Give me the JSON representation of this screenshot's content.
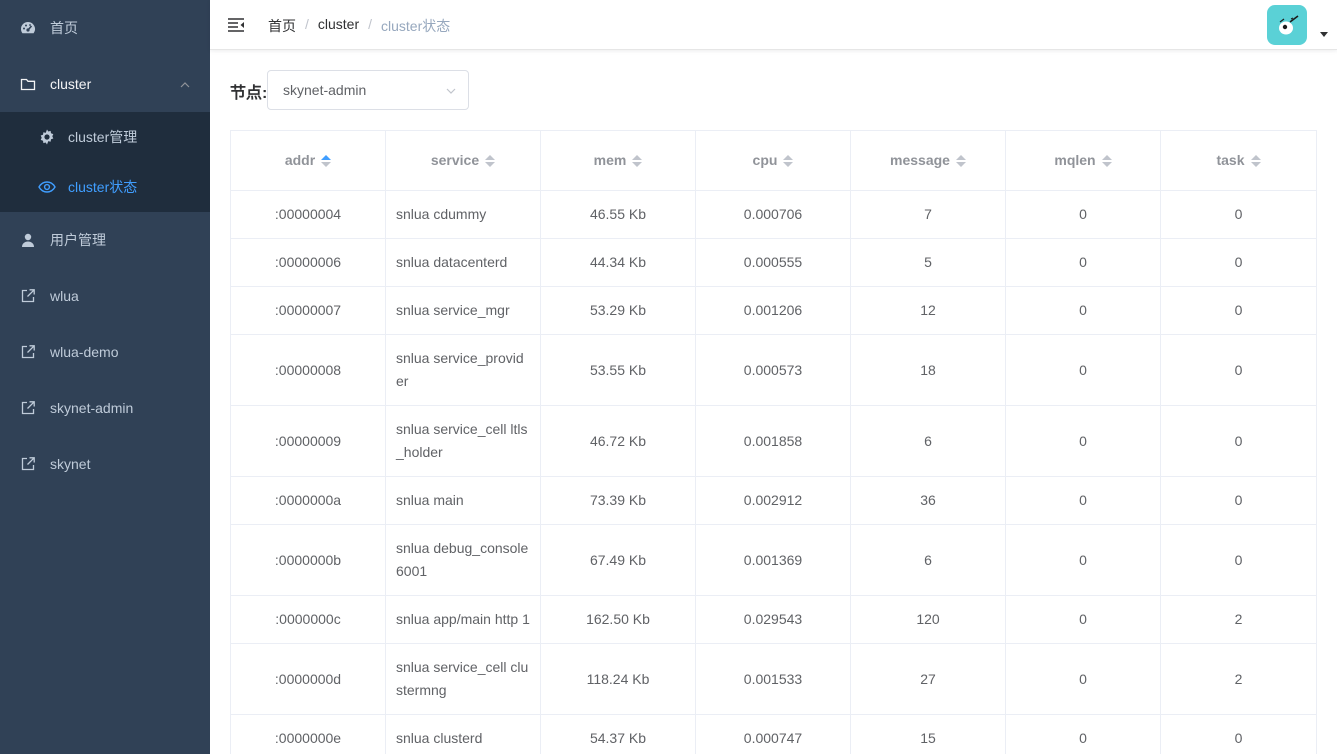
{
  "sidebar": {
    "home": "首页",
    "cluster": "cluster",
    "cluster_manage": "cluster管理",
    "cluster_status": "cluster状态",
    "user_manage": "用户管理",
    "links": [
      "wlua",
      "wlua-demo",
      "skynet-admin",
      "skynet"
    ]
  },
  "navbar": {
    "breadcrumb": [
      "首页",
      "cluster",
      "cluster状态"
    ],
    "separator": "/"
  },
  "filter": {
    "node_label": "节点:",
    "node_value": "skynet-admin"
  },
  "table": {
    "columns": [
      "addr",
      "service",
      "mem",
      "cpu",
      "message",
      "mqlen",
      "task"
    ],
    "sorted_column": "addr",
    "rows": [
      [
        ":00000004",
        "snlua cdummy",
        "46.55 Kb",
        "0.000706",
        "7",
        "0",
        "0"
      ],
      [
        ":00000006",
        "snlua datacenterd",
        "44.34 Kb",
        "0.000555",
        "5",
        "0",
        "0"
      ],
      [
        ":00000007",
        "snlua service_mgr",
        "53.29 Kb",
        "0.001206",
        "12",
        "0",
        "0"
      ],
      [
        ":00000008",
        "snlua service_provider",
        "53.55 Kb",
        "0.000573",
        "18",
        "0",
        "0"
      ],
      [
        ":00000009",
        "snlua service_cell ltls_holder",
        "46.72 Kb",
        "0.001858",
        "6",
        "0",
        "0"
      ],
      [
        ":0000000a",
        "snlua main",
        "73.39 Kb",
        "0.002912",
        "36",
        "0",
        "0"
      ],
      [
        ":0000000b",
        "snlua debug_console 6001",
        "67.49 Kb",
        "0.001369",
        "6",
        "0",
        "0"
      ],
      [
        ":0000000c",
        "snlua app/main http 1",
        "162.50 Kb",
        "0.029543",
        "120",
        "0",
        "2"
      ],
      [
        ":0000000d",
        "snlua service_cell clustermng",
        "118.24 Kb",
        "0.001533",
        "27",
        "0",
        "2"
      ],
      [
        ":0000000e",
        "snlua clusterd",
        "54.37 Kb",
        "0.000747",
        "15",
        "0",
        "0"
      ]
    ]
  },
  "colors": {
    "sidebar_bg": "#304156",
    "submenu_bg": "#1f2d3d",
    "active": "#409eff",
    "avatar_bg": "#5ad1d6"
  }
}
